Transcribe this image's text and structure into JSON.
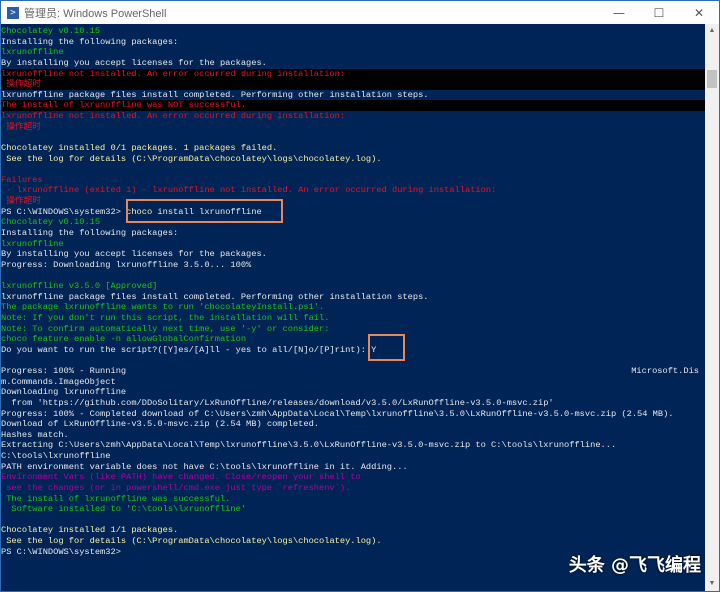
{
  "window": {
    "title": "管理员: Windows PowerShell",
    "icon": "powershell-icon",
    "controls": {
      "minimize": "—",
      "maximize": "☐",
      "close": "✕"
    }
  },
  "colors": {
    "background": "#012456",
    "green": "#16c60c",
    "red": "#e81123",
    "yellow": "#f9f1a5",
    "magenta": "#b4009e",
    "highlight": "#e8875a"
  },
  "console": {
    "lines": [
      {
        "segs": [
          {
            "t": "Chocolatey v0.10.15",
            "c": "green"
          }
        ]
      },
      {
        "segs": [
          {
            "t": "Installing the following packages:",
            "c": "white"
          }
        ]
      },
      {
        "segs": [
          {
            "t": "lxrunoffline",
            "c": "green"
          }
        ]
      },
      {
        "segs": [
          {
            "t": "By installing you accept licenses for the packages.",
            "c": "white"
          }
        ]
      },
      {
        "bg": "err",
        "segs": [
          {
            "t": "lxrunoffline not installed. An error occurred during installation:",
            "c": "red"
          }
        ]
      },
      {
        "bg": "err",
        "segs": [
          {
            "t": " 操作超时",
            "c": "red"
          }
        ]
      },
      {
        "segs": [
          {
            "t": "lxrunoffline package files install completed. Performing other installation steps.",
            "c": "white"
          }
        ]
      },
      {
        "bg": "err",
        "segs": [
          {
            "t": "The install of lxrunoffline was NOT successful.",
            "c": "red"
          }
        ]
      },
      {
        "segs": [
          {
            "t": "lxrunoffline not installed. An error occurred during installation:",
            "c": "red"
          }
        ]
      },
      {
        "segs": [
          {
            "t": " 操作超时",
            "c": "red"
          }
        ]
      },
      {
        "segs": []
      },
      {
        "segs": [
          {
            "t": "Chocolatey installed 0/1 packages. 1 packages failed.",
            "c": "yellow"
          }
        ]
      },
      {
        "segs": [
          {
            "t": " See the log for details (C:\\ProgramData\\chocolatey\\logs\\chocolatey.log).",
            "c": "yellow"
          }
        ]
      },
      {
        "segs": []
      },
      {
        "segs": [
          {
            "t": "Failures",
            "c": "red"
          }
        ]
      },
      {
        "segs": [
          {
            "t": " - lxrunoffline (exited 1) - lxrunoffline not installed. An error occurred during installation:",
            "c": "red"
          }
        ]
      },
      {
        "segs": [
          {
            "t": " 操作超时",
            "c": "red"
          }
        ]
      },
      {
        "segs": [
          {
            "t": "PS C:\\WINDOWS\\system32> ",
            "c": "white"
          },
          {
            "t": "choco",
            "c": "yellow"
          },
          {
            "t": " install lxrunoffline",
            "c": "white"
          }
        ]
      },
      {
        "segs": [
          {
            "t": "Chocolatey v0.10.15",
            "c": "green"
          }
        ]
      },
      {
        "segs": [
          {
            "t": "Installing the following packages:",
            "c": "white"
          }
        ]
      },
      {
        "segs": [
          {
            "t": "lxrunoffline",
            "c": "green"
          }
        ]
      },
      {
        "segs": [
          {
            "t": "By installing you accept licenses for the packages.",
            "c": "white"
          }
        ]
      },
      {
        "segs": [
          {
            "t": "Progress: Downloading lxrunoffline 3.5.0... 100%",
            "c": "white"
          }
        ]
      },
      {
        "segs": []
      },
      {
        "segs": [
          {
            "t": "lxrunoffline v3.5.0 [Approved]",
            "c": "green"
          }
        ]
      },
      {
        "segs": [
          {
            "t": "lxrunoffline package files install completed. Performing other installation steps.",
            "c": "white"
          }
        ]
      },
      {
        "segs": [
          {
            "t": "The package lxrunoffline wants to run 'chocolateyInstall.ps1'.",
            "c": "green"
          }
        ]
      },
      {
        "segs": [
          {
            "t": "Note: If you don't run this script, the installation will fail.",
            "c": "green"
          }
        ]
      },
      {
        "segs": [
          {
            "t": "Note: To confirm automatically next time, use '-y' or consider:",
            "c": "green"
          }
        ]
      },
      {
        "segs": [
          {
            "t": "choco feature enable -n allowGlobalConfirmation",
            "c": "green"
          }
        ]
      },
      {
        "segs": [
          {
            "t": "Do you want to run the script?([Y]es/[A]ll - yes to all/[N]o/[P]rint): Y",
            "c": "white"
          }
        ]
      },
      {
        "segs": []
      },
      {
        "segs": [
          {
            "t": "Progress: 100% - Running",
            "c": "white"
          }
        ],
        "right": "Microsoft.Dis"
      },
      {
        "segs": [
          {
            "t": "m.Commands.ImageObject",
            "c": "white"
          }
        ]
      },
      {
        "segs": [
          {
            "t": "Downloading lxrunoffline",
            "c": "white"
          }
        ]
      },
      {
        "segs": [
          {
            "t": "  from 'https://github.com/DDoSolitary/LxRunOffline/releases/download/v3.5.0/LxRunOffline-v3.5.0-msvc.zip'",
            "c": "white"
          }
        ]
      },
      {
        "segs": [
          {
            "t": "Progress: 100% - Completed download of C:\\Users\\zmh\\AppData\\Local\\Temp\\lxrunoffline\\3.5.0\\LxRunOffline-v3.5.0-msvc.zip (2.54 MB).",
            "c": "white"
          }
        ]
      },
      {
        "segs": [
          {
            "t": "Download of LxRunOffline-v3.5.0-msvc.zip (2.54 MB) completed.",
            "c": "white"
          }
        ]
      },
      {
        "segs": [
          {
            "t": "Hashes match.",
            "c": "white"
          }
        ]
      },
      {
        "segs": [
          {
            "t": "Extracting C:\\Users\\zmh\\AppData\\Local\\Temp\\lxrunoffline\\3.5.0\\LxRunOffline-v3.5.0-msvc.zip to C:\\tools\\lxrunoffline...",
            "c": "white"
          }
        ]
      },
      {
        "segs": [
          {
            "t": "C:\\tools\\lxrunoffline",
            "c": "white"
          }
        ]
      },
      {
        "segs": [
          {
            "t": "PATH environment variable does not have C:\\tools\\lxrunoffline in it. Adding...",
            "c": "white"
          }
        ]
      },
      {
        "segs": [
          {
            "t": "Environment Vars (like PATH) have changed. Close/reopen your shell to",
            "c": "magenta"
          }
        ]
      },
      {
        "segs": [
          {
            "t": " see the changes (or in powershell/cmd.exe just type `refreshenv`).",
            "c": "magenta"
          }
        ]
      },
      {
        "segs": [
          {
            "t": " The install of lxrunoffline was successful.",
            "c": "green"
          }
        ]
      },
      {
        "segs": [
          {
            "t": "  Software installed to 'C:\\tools\\lxrunoffline'",
            "c": "green"
          }
        ]
      },
      {
        "segs": []
      },
      {
        "segs": [
          {
            "t": "Chocolatey installed 1/1 packages.",
            "c": "yellow"
          }
        ]
      },
      {
        "segs": [
          {
            "t": " See the log for details (C:\\ProgramData\\chocolatey\\logs\\chocolatey.log).",
            "c": "yellow"
          }
        ]
      },
      {
        "segs": [
          {
            "t": "PS C:\\WINDOWS\\system32>",
            "c": "white"
          }
        ]
      }
    ]
  },
  "scrollbar": {
    "up": "▲",
    "down": "▼"
  },
  "watermark": "头条 @飞飞编程"
}
